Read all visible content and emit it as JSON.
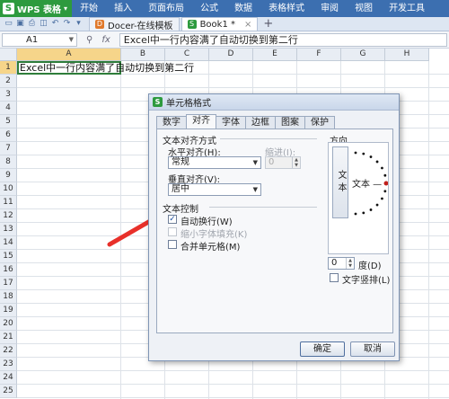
{
  "app": {
    "title": "WPS 表格",
    "logo": "S",
    "menu": [
      "开始",
      "插入",
      "页面布局",
      "公式",
      "数据",
      "表格样式",
      "审阅",
      "视图",
      "开发工具"
    ]
  },
  "tabs": [
    {
      "label": "Docer-在线模板",
      "icon": "docer-icon"
    },
    {
      "label": "Book1 *",
      "icon": "sheet-icon"
    }
  ],
  "formula_bar": {
    "cell_ref": "A1",
    "fx_label": "fx",
    "value": "Excel中一行内容满了自动切换到第二行"
  },
  "sheet": {
    "columns": [
      "A",
      "B",
      "C",
      "D",
      "E",
      "F",
      "G",
      "H"
    ],
    "rows": [
      "1",
      "2",
      "3",
      "4",
      "5",
      "6",
      "7",
      "8",
      "9",
      "10",
      "11",
      "12",
      "13",
      "14",
      "15",
      "16",
      "17",
      "18",
      "19",
      "20",
      "21",
      "22",
      "23",
      "24",
      "25"
    ],
    "a1_text": "Excel中一行内容满了自动切换到第二行"
  },
  "dialog": {
    "title": "单元格格式",
    "tabs": [
      "数字",
      "对齐",
      "字体",
      "边框",
      "图案",
      "保护"
    ],
    "active_tab": "对齐",
    "alignment_section": "文本对齐方式",
    "horizontal_label": "水平对齐(H):",
    "horizontal_value": "常规",
    "indent_label": "缩进(I):",
    "indent_value": "0",
    "vertical_label": "垂直对齐(V):",
    "vertical_value": "居中",
    "control_section": "文本控制",
    "wrap_text": {
      "label": "自动换行(W)",
      "checked": true
    },
    "shrink_to_fit": {
      "label": "缩小字体填充(K)",
      "checked": false
    },
    "merge_cells": {
      "label": "合并单元格(M)",
      "checked": false
    },
    "orientation_section": "方向",
    "orientation_vertical_text": "文本",
    "orientation_horizontal_text": "文本 —",
    "degrees_value": "0",
    "degrees_label": "度(D)",
    "vertical_text": {
      "label": "文字竖排(L)",
      "checked": false
    },
    "ok_label": "确定",
    "cancel_label": "取消"
  },
  "colors": {
    "ribbon": "#3c6fb0",
    "app_button": "#2d9a3e",
    "selection_border": "#2e7d3a",
    "header_highlight": "#f6d58a",
    "arrow": "#e8302a"
  }
}
